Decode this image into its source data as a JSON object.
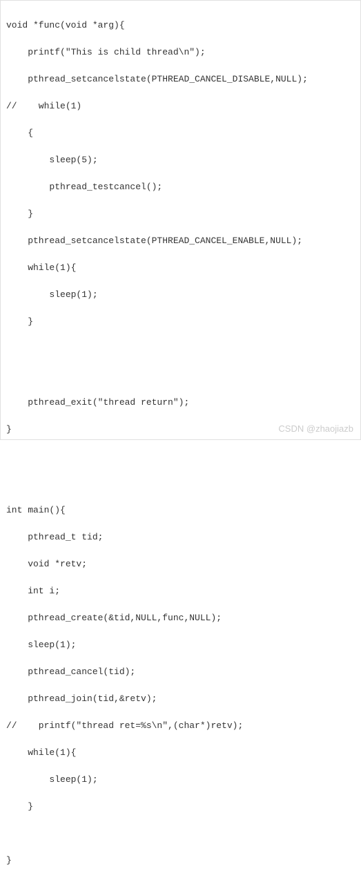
{
  "code": {
    "line1": "void *func(void *arg){",
    "line2": "    printf(\"This is child thread\\n\");",
    "line3": "    pthread_setcancelstate(PTHREAD_CANCEL_DISABLE,NULL);",
    "line4": "//    while(1)",
    "line5": "    {",
    "line6": "        sleep(5);",
    "line7": "        pthread_testcancel();",
    "line8": "    }",
    "line9": "    pthread_setcancelstate(PTHREAD_CANCEL_ENABLE,NULL);",
    "line10": "    while(1){",
    "line11": "        sleep(1);",
    "line12": "    }",
    "line13": "",
    "line14": "",
    "line15": "    pthread_exit(\"thread return\");",
    "line16": "}",
    "line17": "",
    "line18": "",
    "line19": "int main(){",
    "line20": "    pthread_t tid;",
    "line21": "    void *retv;",
    "line22": "    int i;",
    "line23": "    pthread_create(&tid,NULL,func,NULL);",
    "line24": "    sleep(1);",
    "line25": "    pthread_cancel(tid);",
    "line26": "    pthread_join(tid,&retv);",
    "line27": "//    printf(\"thread ret=%s\\n\",(char*)retv);",
    "line28": "    while(1){    ",
    "line29": "        sleep(1);",
    "line30": "    } ",
    "line31": "",
    "line32": "}"
  },
  "watermark": "CSDN @zhaojiazb"
}
